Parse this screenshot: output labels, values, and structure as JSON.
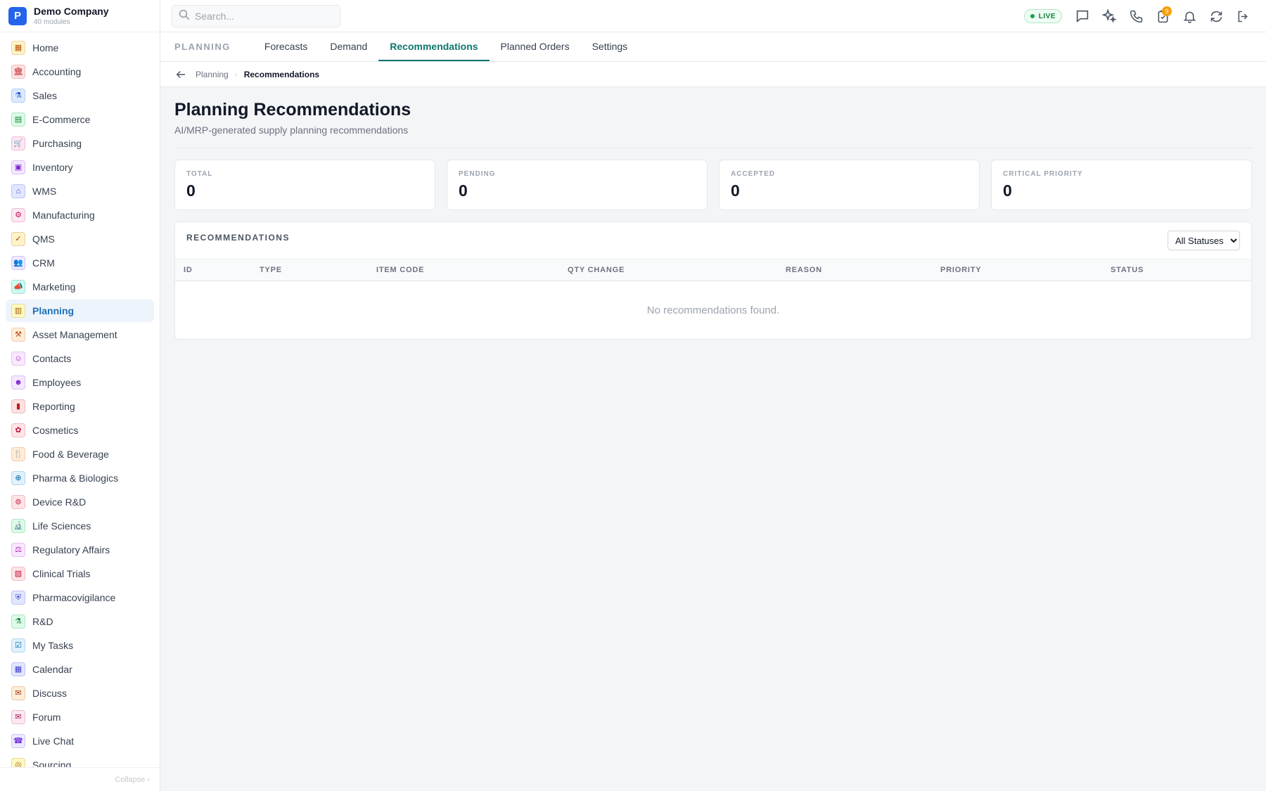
{
  "brand": {
    "logo_letter": "P",
    "name": "Demo Company",
    "subtitle": "40 modules"
  },
  "sidebar": {
    "items": [
      {
        "label": "Home",
        "icon": "grid-icon",
        "glyph": "▦",
        "bg": "#fef3c7",
        "fg": "#b45309"
      },
      {
        "label": "Accounting",
        "icon": "bank-icon",
        "glyph": "🏛",
        "bg": "#fee2e2",
        "fg": "#b91c1c"
      },
      {
        "label": "Sales",
        "icon": "flask-icon",
        "glyph": "⚗",
        "bg": "#dbeafe",
        "fg": "#1d4ed8"
      },
      {
        "label": "E-Commerce",
        "icon": "store-icon",
        "glyph": "▤",
        "bg": "#dcfce7",
        "fg": "#15803d"
      },
      {
        "label": "Purchasing",
        "icon": "cart-icon",
        "glyph": "🛒",
        "bg": "#fce7f3",
        "fg": "#be185d"
      },
      {
        "label": "Inventory",
        "icon": "box-icon",
        "glyph": "▣",
        "bg": "#f3e8ff",
        "fg": "#7e22ce"
      },
      {
        "label": "WMS",
        "icon": "warehouse-icon",
        "glyph": "⌂",
        "bg": "#e0e7ff",
        "fg": "#4338ca"
      },
      {
        "label": "Manufacturing",
        "icon": "factory-icon",
        "glyph": "⚙",
        "bg": "#fce7f3",
        "fg": "#be185d"
      },
      {
        "label": "QMS",
        "icon": "badge-check-icon",
        "glyph": "✓",
        "bg": "#fef3c7",
        "fg": "#92400e"
      },
      {
        "label": "CRM",
        "icon": "users-icon",
        "glyph": "👥",
        "bg": "#ede9fe",
        "fg": "#6d28d9"
      },
      {
        "label": "Marketing",
        "icon": "megaphone-icon",
        "glyph": "📣",
        "bg": "#ccfbf1",
        "fg": "#0f766e"
      },
      {
        "label": "Planning",
        "icon": "calendar-plan-icon",
        "glyph": "▥",
        "bg": "#fef9c3",
        "fg": "#a16207"
      },
      {
        "label": "Asset Management",
        "icon": "tools-icon",
        "glyph": "⚒",
        "bg": "#ffedd5",
        "fg": "#c2410c"
      },
      {
        "label": "Contacts",
        "icon": "contact-icon",
        "glyph": "☺",
        "bg": "#fae8ff",
        "fg": "#a21caf"
      },
      {
        "label": "Employees",
        "icon": "employees-icon",
        "glyph": "☻",
        "bg": "#f3e8ff",
        "fg": "#7e22ce"
      },
      {
        "label": "Reporting",
        "icon": "bar-chart-icon",
        "glyph": "▮",
        "bg": "#fee2e2",
        "fg": "#b91c1c"
      },
      {
        "label": "Cosmetics",
        "icon": "flower-icon",
        "glyph": "✿",
        "bg": "#ffe4e6",
        "fg": "#be123c"
      },
      {
        "label": "Food & Beverage",
        "icon": "utensils-icon",
        "glyph": "🍴",
        "bg": "#ffedd5",
        "fg": "#c2410c"
      },
      {
        "label": "Pharma & Biologics",
        "icon": "pill-icon",
        "glyph": "⊕",
        "bg": "#e0f2fe",
        "fg": "#0369a1"
      },
      {
        "label": "Device R&D",
        "icon": "device-icon",
        "glyph": "⊚",
        "bg": "#ffe4e6",
        "fg": "#be123c"
      },
      {
        "label": "Life Sciences",
        "icon": "microscope-icon",
        "glyph": "🔬",
        "bg": "#dcfce7",
        "fg": "#15803d"
      },
      {
        "label": "Regulatory Affairs",
        "icon": "gavel-icon",
        "glyph": "⚖",
        "bg": "#fae8ff",
        "fg": "#a21caf"
      },
      {
        "label": "Clinical Trials",
        "icon": "clipboard-icon",
        "glyph": "▨",
        "bg": "#ffe4e6",
        "fg": "#be123c"
      },
      {
        "label": "Pharmacovigilance",
        "icon": "shield-icon",
        "glyph": "⛨",
        "bg": "#e0e7ff",
        "fg": "#4338ca"
      },
      {
        "label": "R&D",
        "icon": "beaker-icon",
        "glyph": "⚗",
        "bg": "#dcfce7",
        "fg": "#15803d"
      },
      {
        "label": "My Tasks",
        "icon": "checklist-icon",
        "glyph": "☑",
        "bg": "#e0f2fe",
        "fg": "#0369a1"
      },
      {
        "label": "Calendar",
        "icon": "calendar-icon",
        "glyph": "▦",
        "bg": "#e0e7ff",
        "fg": "#4338ca"
      },
      {
        "label": "Discuss",
        "icon": "chat-bubbles-icon",
        "glyph": "✉",
        "bg": "#ffedd5",
        "fg": "#9a3412"
      },
      {
        "label": "Forum",
        "icon": "forum-icon",
        "glyph": "✉",
        "bg": "#fce7f3",
        "fg": "#9d174d"
      },
      {
        "label": "Live Chat",
        "icon": "headset-icon",
        "glyph": "☎",
        "bg": "#ede9fe",
        "fg": "#6d28d9"
      },
      {
        "label": "Sourcing",
        "icon": "sourcing-icon",
        "glyph": "◎",
        "bg": "#fef9c3",
        "fg": "#a16207"
      }
    ],
    "active_index": 11,
    "collapse_label": "Collapse ‹"
  },
  "topbar": {
    "search_placeholder": "Search...",
    "live_label": "LIVE",
    "notification_count": "9"
  },
  "tabs": {
    "section": "PLANNING",
    "items": [
      "Forecasts",
      "Demand",
      "Recommendations",
      "Planned Orders",
      "Settings"
    ],
    "active": "Recommendations"
  },
  "breadcrumb": {
    "parent": "Planning",
    "current": "Recommendations"
  },
  "page": {
    "title": "Planning Recommendations",
    "subtitle": "AI/MRP-generated supply planning recommendations"
  },
  "stats": [
    {
      "label": "TOTAL",
      "value": "0"
    },
    {
      "label": "PENDING",
      "value": "0"
    },
    {
      "label": "ACCEPTED",
      "value": "0"
    },
    {
      "label": "CRITICAL PRIORITY",
      "value": "0"
    }
  ],
  "table": {
    "title": "RECOMMENDATIONS",
    "filter_options": [
      "All Statuses"
    ],
    "filter_selected": "All Statuses",
    "columns": [
      "ID",
      "TYPE",
      "ITEM CODE",
      "QTY CHANGE",
      "REASON",
      "PRIORITY",
      "STATUS"
    ],
    "empty_message": "No recommendations found."
  }
}
